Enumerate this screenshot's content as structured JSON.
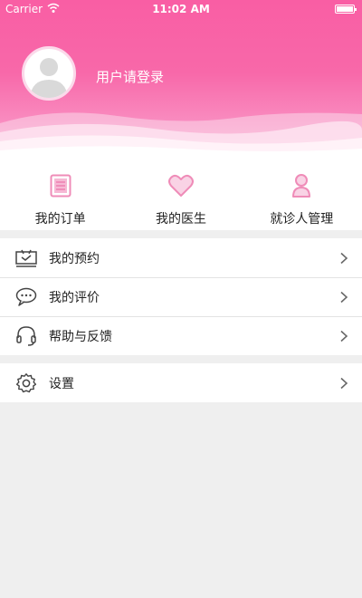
{
  "status_bar": {
    "carrier": "Carrier",
    "time": "11:02 AM"
  },
  "profile": {
    "login_prompt": "用户请登录"
  },
  "quick_actions": [
    {
      "label": "我的订单",
      "icon": "order-list-icon"
    },
    {
      "label": "我的医生",
      "icon": "heart-icon"
    },
    {
      "label": "就诊人管理",
      "icon": "person-icon"
    }
  ],
  "menu_group_1": [
    {
      "label": "我的预约",
      "icon": "calendar-screen-icon"
    },
    {
      "label": "我的评价",
      "icon": "chat-bubble-icon"
    },
    {
      "label": "帮助与反馈",
      "icon": "headset-icon"
    }
  ],
  "menu_group_2": [
    {
      "label": "设置",
      "icon": "gear-icon"
    }
  ],
  "colors": {
    "accent": "#f86aa8",
    "icon_pink": "#ef8cb8",
    "background": "#efefef"
  }
}
